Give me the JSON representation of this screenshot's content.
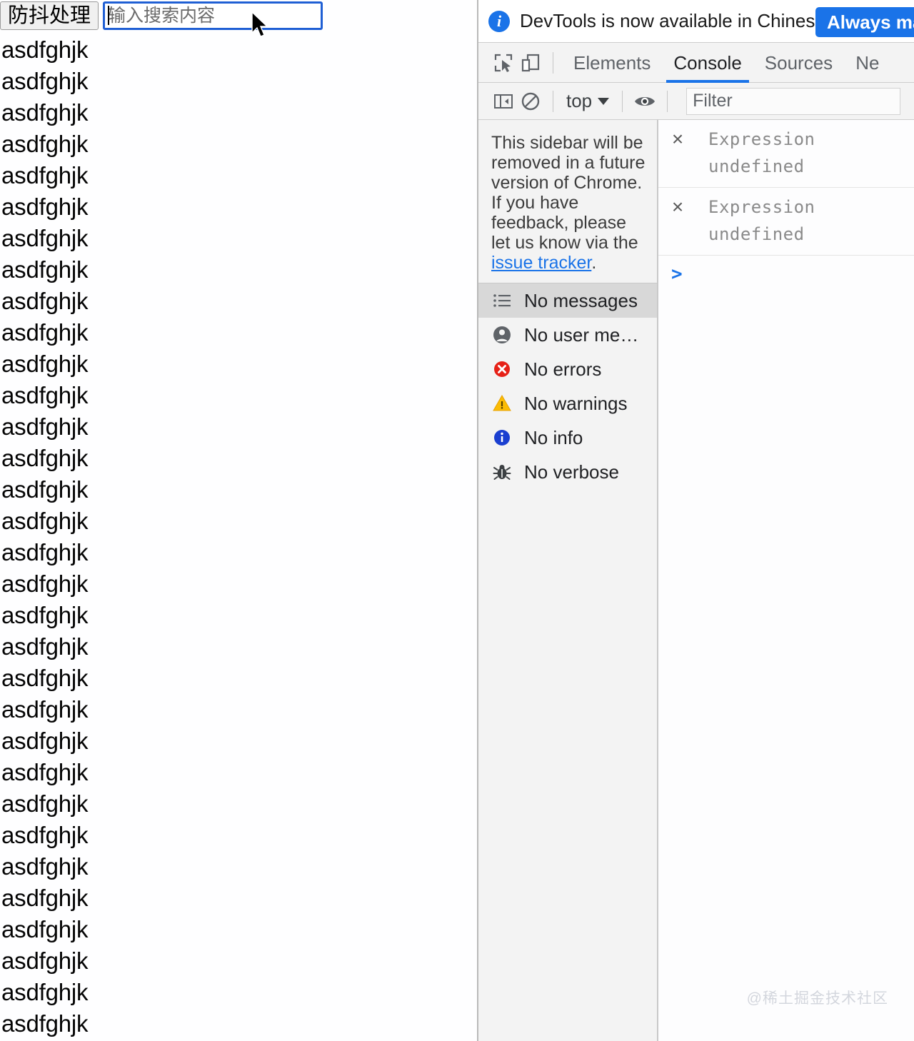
{
  "page": {
    "debounce_button_label": "防抖处理",
    "search": {
      "value": "",
      "placeholder": "输入搜索内容",
      "focused": true,
      "focus_outline_color": "#1f5fd4"
    },
    "list_item_text": "asdfghjk",
    "list_item_count": 32
  },
  "devtools": {
    "infobar": {
      "icon": "info-icon",
      "message": "DevTools is now available in Chinese!",
      "action_label": "Always matc",
      "action_color": "#1a73e8"
    },
    "toolbar_icons": [
      {
        "name": "inspect-element-icon"
      },
      {
        "name": "device-toolbar-icon"
      }
    ],
    "tabs": [
      {
        "label": "Elements",
        "active": false
      },
      {
        "label": "Console",
        "active": true
      },
      {
        "label": "Sources",
        "active": false
      },
      {
        "label": "Ne",
        "active": false
      }
    ],
    "console_toolbar": {
      "sidebar_toggle_icon": "sidebar-toggle-icon",
      "clear_console_icon": "clear-console-icon",
      "context_value": "top",
      "live_expression_icon": "eye-icon",
      "filter": {
        "value": "",
        "placeholder": "Filter"
      }
    },
    "sidebar": {
      "notice_text_before": "This sidebar will be removed in a future version of Chrome. If you have feedback, please let us know via the ",
      "notice_link": "issue tracker",
      "notice_text_after": ".",
      "entries": [
        {
          "icon": "list-icon",
          "label": "No messages",
          "selected": true
        },
        {
          "icon": "user-icon",
          "label": "No user me…",
          "selected": false
        },
        {
          "icon": "error-icon",
          "label": "No errors",
          "selected": false
        },
        {
          "icon": "warning-icon",
          "label": "No warnings",
          "selected": false
        },
        {
          "icon": "info-icon",
          "label": "No info",
          "selected": false
        },
        {
          "icon": "verbose-bug-icon",
          "label": "No verbose",
          "selected": false
        }
      ]
    },
    "messages": [
      {
        "name": "Expression",
        "value": "undefined"
      },
      {
        "name": "Expression",
        "value": "undefined"
      }
    ],
    "prompt_symbol": ">"
  },
  "watermark": "@稀土掘金技术社区"
}
